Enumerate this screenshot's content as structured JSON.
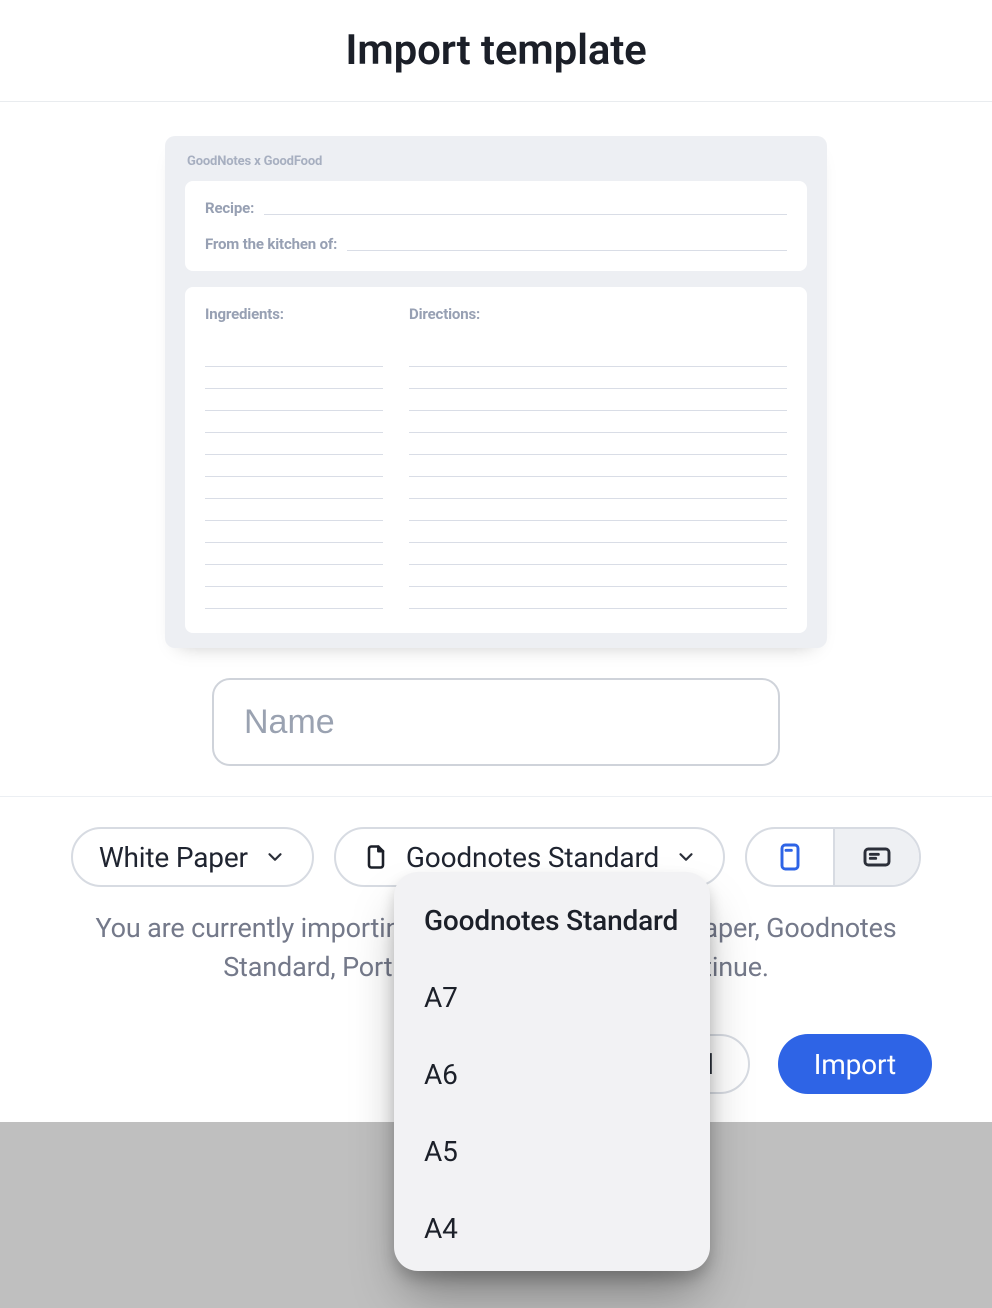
{
  "header": {
    "title": "Import template"
  },
  "preview": {
    "brand": "GoodNotes x GoodFood",
    "recipe_label": "Recipe:",
    "kitchen_label": "From the kitchen of:",
    "ingredients_label": "Ingredients:",
    "directions_label": "Directions:"
  },
  "name_field": {
    "placeholder": "Name",
    "value": ""
  },
  "options": {
    "paper": {
      "label": "White Paper"
    },
    "size": {
      "label": "Goodnotes Standard"
    },
    "orientation": {
      "portrait_selected": true
    }
  },
  "size_menu": {
    "items": [
      {
        "label": "Goodnotes Standard",
        "selected": true
      },
      {
        "label": "A7"
      },
      {
        "label": "A6"
      },
      {
        "label": "A5"
      },
      {
        "label": "A4"
      }
    ]
  },
  "status": {
    "line": "You are currently importing the template as White Paper, Goodnotes Standard, Portrait. Please confirm to continue."
  },
  "actions": {
    "cancel": "Cancel",
    "import": "Import"
  }
}
